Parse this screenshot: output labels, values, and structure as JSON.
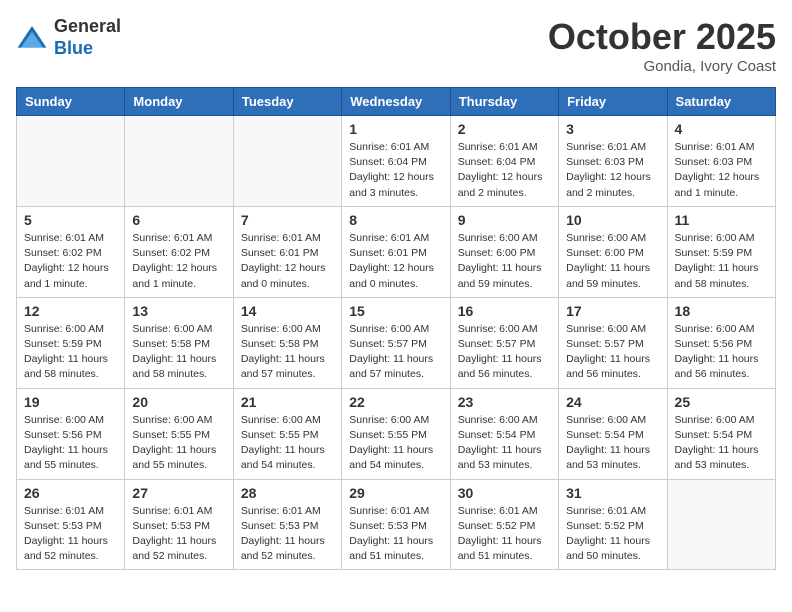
{
  "header": {
    "logo_line1": "General",
    "logo_line2": "Blue",
    "month": "October 2025",
    "location": "Gondia, Ivory Coast"
  },
  "weekdays": [
    "Sunday",
    "Monday",
    "Tuesday",
    "Wednesday",
    "Thursday",
    "Friday",
    "Saturday"
  ],
  "weeks": [
    [
      {
        "day": "",
        "info": ""
      },
      {
        "day": "",
        "info": ""
      },
      {
        "day": "",
        "info": ""
      },
      {
        "day": "1",
        "info": "Sunrise: 6:01 AM\nSunset: 6:04 PM\nDaylight: 12 hours\nand 3 minutes."
      },
      {
        "day": "2",
        "info": "Sunrise: 6:01 AM\nSunset: 6:04 PM\nDaylight: 12 hours\nand 2 minutes."
      },
      {
        "day": "3",
        "info": "Sunrise: 6:01 AM\nSunset: 6:03 PM\nDaylight: 12 hours\nand 2 minutes."
      },
      {
        "day": "4",
        "info": "Sunrise: 6:01 AM\nSunset: 6:03 PM\nDaylight: 12 hours\nand 1 minute."
      }
    ],
    [
      {
        "day": "5",
        "info": "Sunrise: 6:01 AM\nSunset: 6:02 PM\nDaylight: 12 hours\nand 1 minute."
      },
      {
        "day": "6",
        "info": "Sunrise: 6:01 AM\nSunset: 6:02 PM\nDaylight: 12 hours\nand 1 minute."
      },
      {
        "day": "7",
        "info": "Sunrise: 6:01 AM\nSunset: 6:01 PM\nDaylight: 12 hours\nand 0 minutes."
      },
      {
        "day": "8",
        "info": "Sunrise: 6:01 AM\nSunset: 6:01 PM\nDaylight: 12 hours\nand 0 minutes."
      },
      {
        "day": "9",
        "info": "Sunrise: 6:00 AM\nSunset: 6:00 PM\nDaylight: 11 hours\nand 59 minutes."
      },
      {
        "day": "10",
        "info": "Sunrise: 6:00 AM\nSunset: 6:00 PM\nDaylight: 11 hours\nand 59 minutes."
      },
      {
        "day": "11",
        "info": "Sunrise: 6:00 AM\nSunset: 5:59 PM\nDaylight: 11 hours\nand 58 minutes."
      }
    ],
    [
      {
        "day": "12",
        "info": "Sunrise: 6:00 AM\nSunset: 5:59 PM\nDaylight: 11 hours\nand 58 minutes."
      },
      {
        "day": "13",
        "info": "Sunrise: 6:00 AM\nSunset: 5:58 PM\nDaylight: 11 hours\nand 58 minutes."
      },
      {
        "day": "14",
        "info": "Sunrise: 6:00 AM\nSunset: 5:58 PM\nDaylight: 11 hours\nand 57 minutes."
      },
      {
        "day": "15",
        "info": "Sunrise: 6:00 AM\nSunset: 5:57 PM\nDaylight: 11 hours\nand 57 minutes."
      },
      {
        "day": "16",
        "info": "Sunrise: 6:00 AM\nSunset: 5:57 PM\nDaylight: 11 hours\nand 56 minutes."
      },
      {
        "day": "17",
        "info": "Sunrise: 6:00 AM\nSunset: 5:57 PM\nDaylight: 11 hours\nand 56 minutes."
      },
      {
        "day": "18",
        "info": "Sunrise: 6:00 AM\nSunset: 5:56 PM\nDaylight: 11 hours\nand 56 minutes."
      }
    ],
    [
      {
        "day": "19",
        "info": "Sunrise: 6:00 AM\nSunset: 5:56 PM\nDaylight: 11 hours\nand 55 minutes."
      },
      {
        "day": "20",
        "info": "Sunrise: 6:00 AM\nSunset: 5:55 PM\nDaylight: 11 hours\nand 55 minutes."
      },
      {
        "day": "21",
        "info": "Sunrise: 6:00 AM\nSunset: 5:55 PM\nDaylight: 11 hours\nand 54 minutes."
      },
      {
        "day": "22",
        "info": "Sunrise: 6:00 AM\nSunset: 5:55 PM\nDaylight: 11 hours\nand 54 minutes."
      },
      {
        "day": "23",
        "info": "Sunrise: 6:00 AM\nSunset: 5:54 PM\nDaylight: 11 hours\nand 53 minutes."
      },
      {
        "day": "24",
        "info": "Sunrise: 6:00 AM\nSunset: 5:54 PM\nDaylight: 11 hours\nand 53 minutes."
      },
      {
        "day": "25",
        "info": "Sunrise: 6:00 AM\nSunset: 5:54 PM\nDaylight: 11 hours\nand 53 minutes."
      }
    ],
    [
      {
        "day": "26",
        "info": "Sunrise: 6:01 AM\nSunset: 5:53 PM\nDaylight: 11 hours\nand 52 minutes."
      },
      {
        "day": "27",
        "info": "Sunrise: 6:01 AM\nSunset: 5:53 PM\nDaylight: 11 hours\nand 52 minutes."
      },
      {
        "day": "28",
        "info": "Sunrise: 6:01 AM\nSunset: 5:53 PM\nDaylight: 11 hours\nand 52 minutes."
      },
      {
        "day": "29",
        "info": "Sunrise: 6:01 AM\nSunset: 5:53 PM\nDaylight: 11 hours\nand 51 minutes."
      },
      {
        "day": "30",
        "info": "Sunrise: 6:01 AM\nSunset: 5:52 PM\nDaylight: 11 hours\nand 51 minutes."
      },
      {
        "day": "31",
        "info": "Sunrise: 6:01 AM\nSunset: 5:52 PM\nDaylight: 11 hours\nand 50 minutes."
      },
      {
        "day": "",
        "info": ""
      }
    ]
  ]
}
